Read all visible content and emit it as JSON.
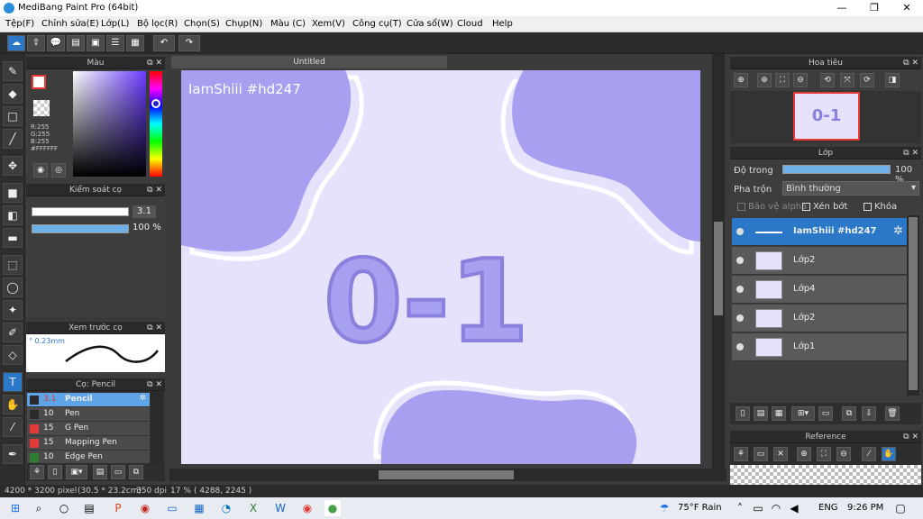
{
  "window": {
    "title": "MediBang Paint Pro (64bit)"
  },
  "menu": [
    "Tệp(F)",
    "Chỉnh sửa(E)",
    "Lớp(L)",
    "Bộ lọc(R)",
    "Chọn(S)",
    "Chụp(N)",
    "Màu (C)",
    "Xem(V)",
    "Công cụ(T)",
    "Cửa sổ(W)",
    "Cloud",
    "Help"
  ],
  "document": {
    "tab_title": "Untitled",
    "watermark": "IamShiii #hd247",
    "art_text": "0-1"
  },
  "color_panel": {
    "title": "Màu",
    "r": "R:255",
    "g": "G:255",
    "b": "B:255",
    "hex": "#FFFFFF"
  },
  "brush_control": {
    "title": "Kiểm soát cọ",
    "size": "3.1",
    "opacity": "100 %",
    "opacity_value": 1.0
  },
  "brush_preview": {
    "title": "Xem trước cọ",
    "size_text": "° 0.23mm"
  },
  "brush_list": {
    "title": "Cọ: Pencil",
    "items": [
      {
        "size": "3.1",
        "name": "Pencil",
        "color": "#2b2b2b",
        "active": true
      },
      {
        "size": "10",
        "name": "Pen",
        "color": "#2b2b2b",
        "active": false
      },
      {
        "size": "15",
        "name": "G Pen",
        "color": "#e53935",
        "active": false
      },
      {
        "size": "15",
        "name": "Mapping Pen",
        "color": "#e53935",
        "active": false
      },
      {
        "size": "10",
        "name": "Edge Pen",
        "color": "#2e7d32",
        "active": false
      }
    ]
  },
  "navigator": {
    "title": "Hoa tiêu"
  },
  "layer_panel": {
    "title": "Lớp",
    "opacity_label": "Độ trong",
    "opacity_value": "100 %",
    "opacity_fraction": 1.0,
    "blend_label": "Pha trộn",
    "blend_value": "Bình thường",
    "protect_alpha": "Bảo vệ alpha",
    "clipping": "Xén bớt",
    "lock": "Khóa",
    "layers": [
      {
        "name": "IamShiii #hd247",
        "selected": true
      },
      {
        "name": "Lớp2",
        "selected": false
      },
      {
        "name": "Lớp4",
        "selected": false
      },
      {
        "name": "Lớp2",
        "selected": false
      },
      {
        "name": "Lớp1",
        "selected": false
      }
    ]
  },
  "reference": {
    "title": "Reference"
  },
  "status": {
    "size": "4200 * 3200 pixel",
    "cm": "(30.5 * 23.2cm)",
    "dpi": "350 dpi",
    "zoom": "17 %",
    "coords": "( 4288, 2245 )"
  },
  "taskbar": {
    "weather": "75°F  Rain",
    "lang": "ENG",
    "time": "9:26 PM"
  },
  "colors": {
    "accent": "#2b78c8",
    "lilac": "#a79ff0",
    "lilac_dark": "#8a80dd",
    "canvas_bg": "#e6e2fb"
  }
}
